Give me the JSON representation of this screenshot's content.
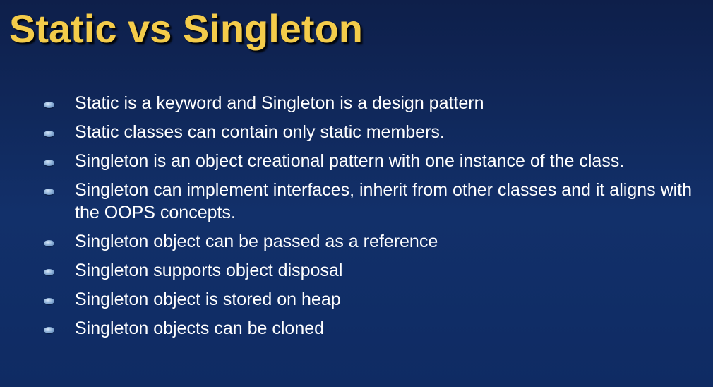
{
  "slide": {
    "title": "Static vs Singleton",
    "bullets": [
      "Static is a keyword and Singleton is a design pattern",
      "Static classes can contain only static members.",
      "Singleton is an object creational pattern with one instance of the class.",
      "Singleton can implement interfaces, inherit from other classes and it aligns with the OOPS concepts.",
      "Singleton object can be passed as a reference",
      "Singleton supports object disposal",
      "Singleton object is stored on heap",
      "Singleton objects can be cloned"
    ]
  },
  "colors": {
    "background": "#12306a",
    "title": "#f4cc4a",
    "text": "#ffffff",
    "bullet": "#8fb3da"
  }
}
